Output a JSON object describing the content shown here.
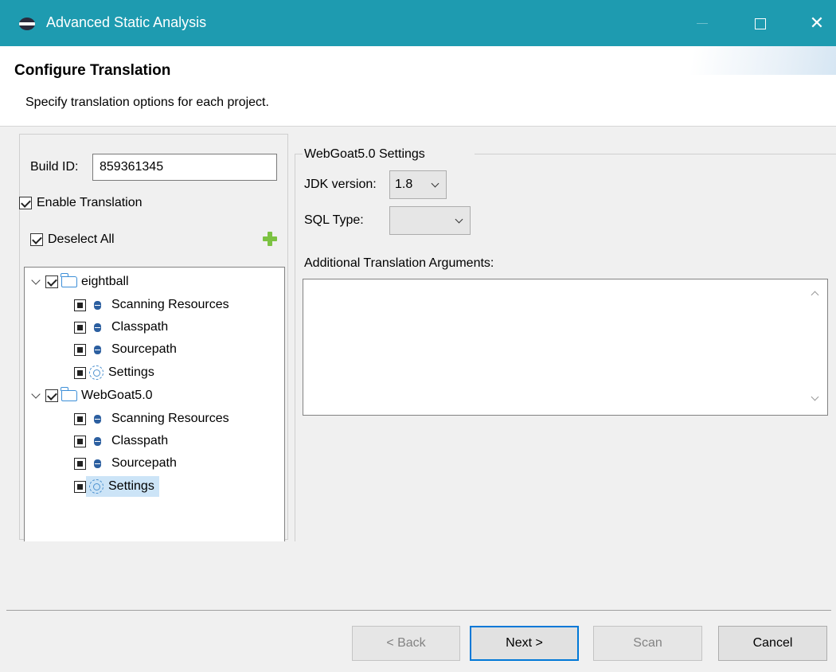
{
  "window": {
    "title": "Advanced Static Analysis",
    "accent_color": "#1e9bb0",
    "controls": [
      "minimize-icon",
      "maximize-icon",
      "close-icon"
    ]
  },
  "header": {
    "title": "Configure Translation",
    "description": "Specify translation options for each project."
  },
  "left": {
    "build_id_label": "Build ID:",
    "build_id_value": "859361345",
    "enable_translation_label": "Enable Translation",
    "enable_translation_checked": true,
    "deselect_all_label": "Deselect All",
    "deselect_all_checked": true,
    "add_icon": "plus-icon"
  },
  "tree": {
    "projects": [
      {
        "name": "eightball",
        "checked": true,
        "expanded": true,
        "children": [
          {
            "label": "Scanning Resources",
            "icon": "resource-icon"
          },
          {
            "label": "Classpath",
            "icon": "resource-icon"
          },
          {
            "label": "Sourcepath",
            "icon": "resource-icon"
          },
          {
            "label": "Settings",
            "icon": "gear-icon"
          }
        ]
      },
      {
        "name": "WebGoat5.0",
        "checked": true,
        "expanded": true,
        "children": [
          {
            "label": "Scanning Resources",
            "icon": "resource-icon"
          },
          {
            "label": "Classpath",
            "icon": "resource-icon"
          },
          {
            "label": "Sourcepath",
            "icon": "resource-icon"
          },
          {
            "label": "Settings",
            "icon": "gear-icon",
            "selected": true
          }
        ]
      }
    ]
  },
  "settings": {
    "group_title": "WebGoat5.0 Settings",
    "jdk_label": "JDK version:",
    "jdk_value": "1.8",
    "sql_label": "SQL Type:",
    "sql_value": "",
    "args_label": "Additional Translation Arguments:",
    "args_value": ""
  },
  "buttons": {
    "back": "< Back",
    "next": "Next >",
    "scan": "Scan",
    "cancel": "Cancel"
  }
}
